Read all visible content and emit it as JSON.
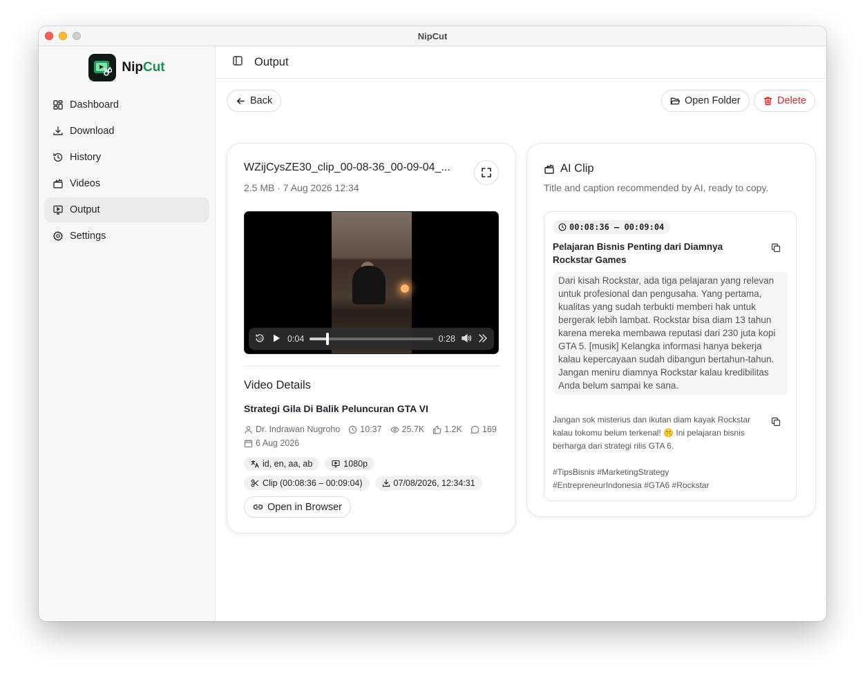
{
  "window": {
    "title": "NipCut"
  },
  "brand": {
    "name_part1": "Nip",
    "name_part2": "Cut"
  },
  "sidebar": {
    "items": [
      {
        "label": "Dashboard",
        "icon": "dashboard-icon",
        "active": false
      },
      {
        "label": "Download",
        "icon": "download-icon",
        "active": false
      },
      {
        "label": "History",
        "icon": "history-icon",
        "active": false
      },
      {
        "label": "Videos",
        "icon": "clapperboard-icon",
        "active": false
      },
      {
        "label": "Output",
        "icon": "monitor-play-icon",
        "active": true
      },
      {
        "label": "Settings",
        "icon": "gear-icon",
        "active": false
      }
    ]
  },
  "header": {
    "title": "Output"
  },
  "toolbar": {
    "back_label": "Back",
    "open_folder_label": "Open Folder",
    "delete_label": "Delete"
  },
  "file": {
    "name": "WZijCysZE30_clip_00-08-36_00-09-04_...",
    "meta": "2.5 MB · 7 Aug 2026 12:34"
  },
  "player": {
    "current_time": "0:04",
    "duration": "0:28",
    "progress": 0.143
  },
  "details": {
    "section_title": "Video Details",
    "video_title": "Strategi Gila Di Balik Peluncuran GTA VI",
    "author": "Dr. Indrawan Nugroho",
    "duration": "10:37",
    "views": "25.7K",
    "likes": "1.2K",
    "comments": "169",
    "date": "6 Aug 2026",
    "languages": "id, en, aa, ab",
    "resolution": "1080p",
    "clip_range": "Clip (00:08:36 – 00:09:04)",
    "downloaded_at": "07/08/2026, 12:34:31",
    "open_browser_label": "Open in Browser"
  },
  "ai_clip": {
    "title": "AI Clip",
    "subtitle": "Title and caption recommended by AI, ready to copy.",
    "time_range": "00:08:36 – 00:09:04",
    "clip_title": "Pelajaran Bisnis Penting dari Diamnya Rockstar Games",
    "description": "Dari kisah Rockstar, ada tiga pelajaran yang relevan untuk profesional dan pengusaha. Yang pertama, kualitas yang sudah terbukti memberi hak untuk bergerak lebih lambat. Rockstar bisa diam 13 tahun karena mereka membawa reputasi dari 230 juta kopi GTA 5. [musik] Kelangka informasi hanya bekerja kalau kepercayaan sudah dibangun bertahun-tahun. Jangan meniru diamnya Rockstar kalau kredibilitas Anda belum sampai ke sana.",
    "caption": "Jangan sok misterius dan ikutan diam kayak Rockstar kalau tokomu belum terkenal! 🤫 Ini pelajaran bisnis berharga dari strategi rilis GTA 6.",
    "hashtags": "#TipsBisnis #MarketingStrategy #EntrepreneurIndonesia #GTA6 #Rockstar"
  },
  "colors": {
    "brand_green": "#1b8f52",
    "delete_red": "#dc2626",
    "active_nav": "#ebebeb"
  }
}
